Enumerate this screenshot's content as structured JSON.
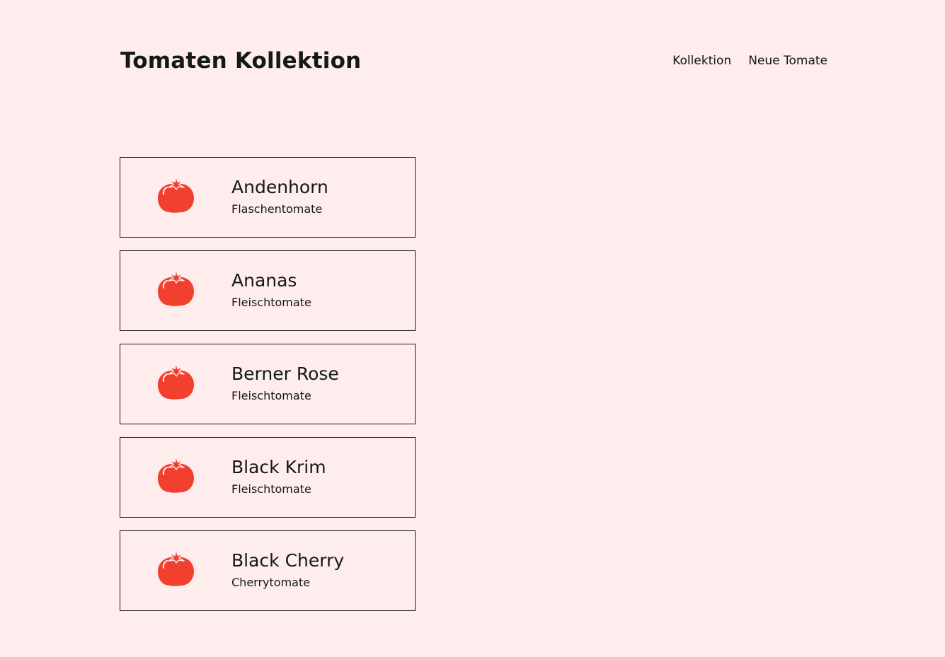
{
  "header": {
    "title": "Tomaten Kollektion",
    "nav": [
      {
        "label": "Kollektion"
      },
      {
        "label": "Neue Tomate"
      }
    ]
  },
  "tomatoes": [
    {
      "name": "Andenhorn",
      "type": "Flaschentomate",
      "icon": "tomato-icon"
    },
    {
      "name": "Ananas",
      "type": "Fleischtomate",
      "icon": "tomato-icon"
    },
    {
      "name": "Berner Rose",
      "type": "Fleischtomate",
      "icon": "tomato-icon"
    },
    {
      "name": "Black Krim",
      "type": "Fleischtomate",
      "icon": "tomato-icon"
    },
    {
      "name": "Black Cherry",
      "type": "Cherrytomate",
      "icon": "tomato-icon"
    }
  ],
  "colors": {
    "background": "#ffecec",
    "text": "#111a17",
    "tomato": "#f2402f",
    "card_border": "#1a1a1a"
  }
}
